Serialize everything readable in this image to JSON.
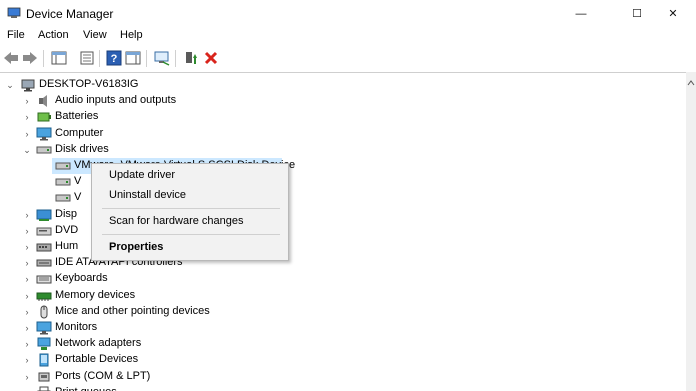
{
  "window": {
    "title": "Device Manager",
    "minimize_glyph": "—",
    "maximize_glyph": "☐",
    "close_glyph": "✕"
  },
  "menu": [
    "File",
    "Action",
    "View",
    "Help"
  ],
  "toolbar_icons": [
    "back-icon",
    "forward-icon",
    "properties-pane-icon",
    "show-hidden-icon",
    "help-icon",
    "action-pane-icon",
    "scan-hardware-icon",
    "update-driver-icon",
    "uninstall-icon"
  ],
  "tree": {
    "root": "DESKTOP-V6183IG",
    "items": [
      "Audio inputs and outputs",
      "Batteries",
      "Computer",
      "Disk drives",
      "VMware, VMware Virtual S SCSI Disk Device",
      "V",
      "V",
      "Disp",
      "DVD",
      "Hum",
      "IDE ATA/ATAPI controllers",
      "Keyboards",
      "Memory devices",
      "Mice and other pointing devices",
      "Monitors",
      "Network adapters",
      "Portable Devices",
      "Ports (COM & LPT)",
      "Print queues"
    ]
  },
  "context_menu": {
    "items": [
      "Update driver",
      "Uninstall device",
      "Scan for hardware changes",
      "Properties"
    ]
  },
  "colors": {
    "selection": "#cce8ff",
    "menu_bg": "#f2f2f2",
    "accent_green": "#2e8b2e",
    "accent_red": "#d9241c"
  }
}
